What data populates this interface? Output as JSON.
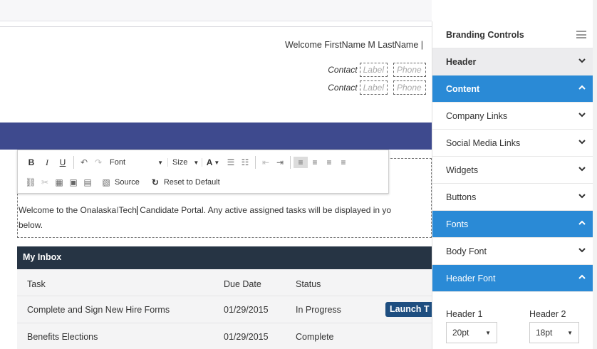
{
  "header": {
    "welcome": "Welcome FirstName M LastName   |",
    "contact_label": "Contact",
    "label_placeholder": "Label",
    "phone_placeholder": "Phone"
  },
  "toolbar": {
    "bold": "B",
    "italic": "I",
    "underline": "U",
    "font_dropdown": "Font",
    "size_dropdown": "Size",
    "source_label": "Source",
    "reset_label": "Reset to Default"
  },
  "editor": {
    "line1_a": "Welcome to the Onalaska",
    "line1_b": "Tech",
    "line1_c": " Candidate Portal. Any active assigned tasks will be displayed in yo",
    "line2": "below."
  },
  "inbox": {
    "title": "My Inbox",
    "columns": [
      "Task",
      "Due Date",
      "Status"
    ],
    "rows": [
      {
        "task": "Complete and Sign New Hire Forms",
        "due": "01/29/2015",
        "status": "In Progress",
        "action": "Launch T"
      },
      {
        "task": "Benefits Elections",
        "due": "01/29/2015",
        "status": "Complete"
      }
    ]
  },
  "panel": {
    "title": "Branding Controls",
    "items": [
      {
        "label": "Header",
        "state": "collapsed"
      },
      {
        "label": "Content",
        "state": "expanded"
      },
      {
        "label": "Company Links",
        "state": "collapsed"
      },
      {
        "label": "Social Media Links",
        "state": "collapsed"
      },
      {
        "label": "Widgets",
        "state": "collapsed"
      },
      {
        "label": "Buttons",
        "state": "collapsed"
      },
      {
        "label": "Fonts",
        "state": "expanded"
      },
      {
        "label": "Body Font",
        "state": "collapsed"
      },
      {
        "label": "Header Font",
        "state": "expanded"
      }
    ],
    "header_font": {
      "h1_label": "Header 1",
      "h1_value": "20pt",
      "h2_label": "Header 2",
      "h2_value": "18pt"
    }
  },
  "colors": {
    "accent_blue": "#2a8ad6",
    "band": "#3e4a8e",
    "inbox_head": "#263444",
    "launch": "#1e4e80"
  }
}
